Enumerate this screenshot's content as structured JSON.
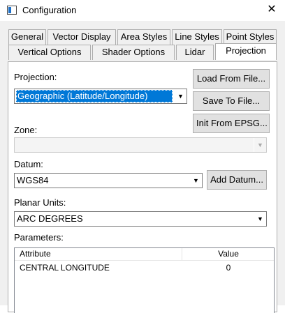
{
  "window": {
    "title": "Configuration",
    "close_glyph": "✕"
  },
  "tabs_row1": [
    "General",
    "Vector Display",
    "Area Styles",
    "Line Styles",
    "Point Styles"
  ],
  "tabs_row2": [
    "Vertical Options",
    "Shader Options",
    "Lidar",
    "Projection"
  ],
  "active_tab": "Projection",
  "projection": {
    "label": "Projection:",
    "value": "Geographic (Latitude/Longitude)",
    "load_button": "Load From File...",
    "save_button": "Save To File...",
    "epsg_button": "Init From EPSG..."
  },
  "zone": {
    "label": "Zone:",
    "value": ""
  },
  "datum": {
    "label": "Datum:",
    "value": "WGS84",
    "add_button": "Add Datum..."
  },
  "planar_units": {
    "label": "Planar Units:",
    "value": "ARC DEGREES"
  },
  "parameters": {
    "label": "Parameters:",
    "columns": [
      "Attribute",
      "Value"
    ],
    "rows": [
      {
        "attribute": "CENTRAL LONGITUDE",
        "value": "0"
      }
    ]
  },
  "icons": {
    "dropdown": "▼"
  }
}
